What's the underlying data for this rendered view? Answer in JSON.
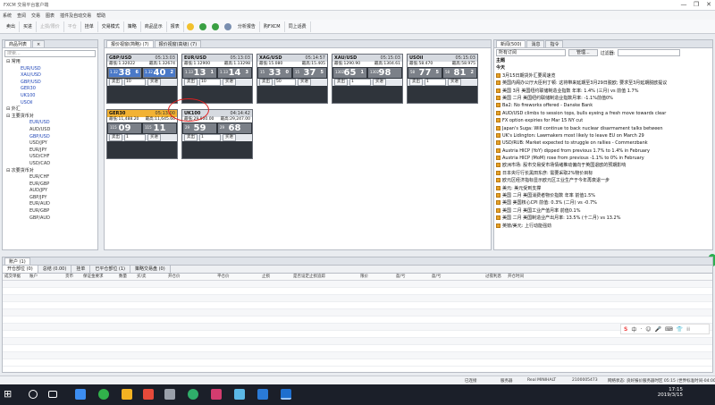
{
  "window": {
    "title": "FXCM 交易平台客户端",
    "controls": [
      "—",
      "❐",
      "✕"
    ]
  },
  "menu": [
    "系统",
    "查阅",
    "交易",
    "图表",
    "插件及自动交易",
    "帮助"
  ],
  "toolbar": [
    {
      "label": "卖出",
      "dim": false
    },
    {
      "label": "买进",
      "dim": false
    },
    {
      "label": "止损/限价",
      "dim": true
    },
    {
      "label": "平仓",
      "dim": true
    },
    {
      "label": "挂单",
      "dim": false
    },
    {
      "label": "交易模式",
      "dim": false
    },
    {
      "label": "策略",
      "dim": false
    },
    {
      "label": "商品显示",
      "dim": false
    },
    {
      "label": "报表",
      "dim": false
    },
    {
      "label": "分析报告",
      "dim": false
    },
    {
      "label": "购FXCM",
      "dim": false
    },
    {
      "label": "同上话费",
      "dim": false
    }
  ],
  "left": {
    "tabs": [
      "商品列表",
      "×"
    ],
    "search_placeholder": "搜索...",
    "items": [
      {
        "cls": "g",
        "text": "⊟ 常用"
      },
      {
        "cls": "s",
        "text": "EUR/USD"
      },
      {
        "cls": "s",
        "text": "XAU/USD"
      },
      {
        "cls": "s",
        "text": "GBP/USD"
      },
      {
        "cls": "s",
        "text": "GER30"
      },
      {
        "cls": "s",
        "text": "UK100"
      },
      {
        "cls": "s",
        "text": "USOil"
      },
      {
        "cls": "g",
        "text": "⊟ 外汇"
      },
      {
        "cls": "g",
        "text": "   ⊟ 主要货币对"
      },
      {
        "cls": "s2",
        "text": "EUR/USD"
      },
      {
        "cls": "n",
        "text": "AUD/USD"
      },
      {
        "cls": "s2",
        "text": "GBP/USD"
      },
      {
        "cls": "n",
        "text": "USD/JPY"
      },
      {
        "cls": "n",
        "text": "EUR/JPY"
      },
      {
        "cls": "n",
        "text": "USD/CHF"
      },
      {
        "cls": "n",
        "text": "USD/CAD"
      },
      {
        "cls": "g",
        "text": "   ⊟ 次要货币对"
      },
      {
        "cls": "n",
        "text": "EUR/CHF"
      },
      {
        "cls": "n",
        "text": "EUR/GBP"
      },
      {
        "cls": "n",
        "text": "AUD/JPY"
      },
      {
        "cls": "n",
        "text": "GBP/JPY"
      },
      {
        "cls": "n",
        "text": "EUR/AUD"
      },
      {
        "cls": "n",
        "text": "EUR/GBP"
      },
      {
        "cls": "n",
        "text": "GBP/AUD"
      }
    ]
  },
  "mid": {
    "tabs": [
      "报价视窗(简略) (7)",
      "报价视窗(高级) (7)"
    ],
    "cards": [
      {
        "sym": "GBP/USD",
        "time": "05:13:03",
        "hl": [
          "最低:1.32022",
          "最高:1.32674"
        ],
        "sell": "38",
        "sellsup": "6",
        "sellsm": "1.32",
        "buy": "40",
        "buysup": "2",
        "buysm": "1.32",
        "orange": false,
        "gray": false,
        "qty": "10"
      },
      {
        "sym": "EUR/USD",
        "time": "05:13:03",
        "hl": [
          "最低:1.12900",
          "最高:1.13298"
        ],
        "sell": "13",
        "sellsup": "1",
        "sellsm": "1.13",
        "buy": "14",
        "buysup": "3",
        "buysm": "1.13",
        "orange": false,
        "gray": true,
        "qty": "10"
      },
      {
        "sym": "XAG/USD",
        "time": "05:14:57",
        "hl": [
          "最低:15.080",
          "最高:15.405"
        ],
        "sell": "33",
        "sellsup": "0",
        "sellsm": "15",
        "buy": "37",
        "buysup": "5",
        "buysm": "15",
        "orange": false,
        "gray": true,
        "qty": "50"
      },
      {
        "sym": "XAU/USD",
        "time": "05:15:03",
        "hl": [
          "最低:1290.90",
          "最高:1304.61"
        ],
        "sell": "65",
        "sellsup": "1",
        "sellsm": "1302",
        "buy": "98",
        "buysup": "",
        "buysm": "1302",
        "orange": false,
        "gray": true,
        "qty": "1"
      },
      {
        "sym": "USOil",
        "time": "05:15:03",
        "hl": [
          "最低:58.470",
          "最高:58.975"
        ],
        "sell": "77",
        "sellsup": "5",
        "sellsm": "58",
        "buy": "81",
        "buysup": "2",
        "buysm": "58",
        "orange": false,
        "gray": true,
        "qty": "1"
      },
      {
        "sym": "GER30",
        "time": "05:13:00",
        "hl": [
          "最低:11,488.20",
          "最高:11,645.60"
        ],
        "sell": "09",
        "sellsup": "",
        "sellsm": "115",
        "buy": "11",
        "buysup": "",
        "buysm": "115",
        "orange": true,
        "gray": true,
        "qty": "1"
      },
      {
        "sym": "UK100",
        "time": "04:14:42",
        "hl": [
          "最低:29,000.00",
          "最高:29,247.00"
        ],
        "sell": "59",
        "sellsup": "",
        "sellsm": "29",
        "buy": "68",
        "buysup": "",
        "buysm": "29",
        "orange": false,
        "gray": true,
        "qty": "1"
      }
    ],
    "sell_label": "卖出",
    "buy_label": "买进"
  },
  "right": {
    "tabs": [
      "新闻(500)",
      "消息",
      "指令"
    ],
    "filter_select": "所有订阅",
    "manage_btn": "管理...",
    "filter_label": "过滤器:",
    "header": "主题",
    "today": "今天",
    "news": [
      "3月15日期货外汇要闻速览",
      "英国内阁办公厅大臣利丁顿: 这将带来延期至3月29日脱欧; 要求至3月延期脱欧提议",
      "美国 3月 美国纽约联储制造业指数 年率: 1.4% (三月) vs 前值 1.7%",
      "美国 二月 美国纽约联储制造业指数月率: -1.1%前值0%",
      "Ba2: No fireworks offered - Danske Bank",
      "AUD/USD climbs to session tops, bulls eyeing a fresh move towards clear",
      "FX option expiries for Mar 15 NY cut",
      "Japan's Suga: Will continue to back nuclear disarmament talks between",
      "UK's Lidington: Lawmakers most likely to leave EU on March 29",
      "USD/RUB: Market expected to struggle on rallies - Commerzbank",
      "Austria HICP (YoY) dipped from previous 1.7% to 1.4% in February",
      "Austria HICP (MoM) rose from previous -1.1% to 0% in February",
      "欧洲市场: 股市交易受市场情绪推动偏向于英国退欧的预期影响",
      "日本央行行长黑田东彦: 需要采取2%物价目标",
      "欧元区经济指标显示欧元区工业生产于今年再衰退一步",
      "美元: 美元受到支撑",
      "美国 二月 美国消费者物价指数 年率 前值1.5%",
      "美国 美国核心CPI 前值: 0.3% (二月) vs -0.7%",
      "美国 二月 美国工业产值月率 前值0.1%",
      "美国 二月 美国制造业产出月率: 13.5% (十二月) vs 13.2%",
      "英镑/美元: 上行动能强劲"
    ]
  },
  "bottom": {
    "tab": "账户 (1)",
    "subtabs": [
      "开仓部位 (0)",
      "总结 (0.00)",
      "挂单",
      "已平仓部位 (1)",
      "策略交易盘 (0)"
    ],
    "cols": [
      "成交单据",
      "账户",
      "货币",
      "保证金要求",
      "数量",
      "买/卖",
      "开仓价",
      "平仓价",
      "止损",
      "是否设定止损追踪",
      "限价",
      "盈/亏",
      "盈/亏",
      "",
      "过夜利息",
      "开仓时间"
    ]
  },
  "status": [
    "已连接",
    "服务器",
    "Real MINIHALT",
    "2100005473",
    "网络状态: 良好",
    "报价服务器时区 05:15 (世界标准时间-04:00)"
  ],
  "clock": {
    "time": "17:15",
    "date": "2019/3/15"
  },
  "ime": [
    "S",
    "中",
    "·",
    "☺",
    "🎤",
    "⌨",
    "👕",
    "⁞⁞"
  ],
  "colors": {
    "accent": "#4a79c8",
    "orange": "#f2b233",
    "highlight": "#e02020",
    "taskbar": "#1b1f29"
  }
}
